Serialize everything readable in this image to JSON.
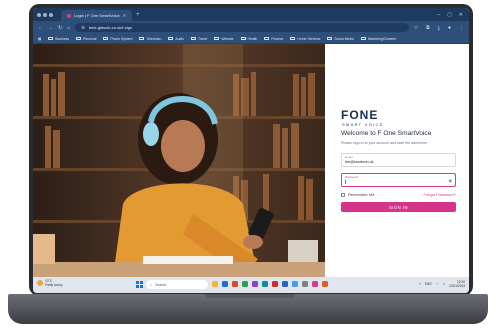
{
  "browser": {
    "tab_title": "Login | F One SmartVoice",
    "url": "fone.gbtsolo.co.uk/f-sign",
    "bookmarks": [
      "Business",
      "Personal",
      "Phone System",
      "Television",
      "Audio",
      "Travel",
      "Website",
      "Health",
      "Finance",
      "Home Services",
      "Social Media",
      "Marketing/Creative"
    ]
  },
  "login": {
    "logo": "FONE",
    "logo_sub": "SMART VOICE",
    "welcome": "Welcome to F One SmartVoice",
    "tagline": "Please sign-in to your account and start the adventure",
    "email_label": "Email",
    "email_value": "lee@fonetech.uk",
    "password_label": "Password",
    "remember": "Remember Me",
    "forgot": "Forgot Password?",
    "signin": "SIGN IN"
  },
  "taskbar": {
    "weather_temp": "10°C",
    "weather_desc": "Partly sunny",
    "search_placeholder": "Search",
    "time": "12:00",
    "date": "22/01/2024",
    "lang": "ENG",
    "app_colors": [
      "#f2b632",
      "#1f6fd1",
      "#e0452e",
      "#2e9e4f",
      "#8a3fd1",
      "#0f8a9e",
      "#cc2f2f",
      "#2d63c8",
      "#4a9be8",
      "#7b7f86",
      "#d93a8e",
      "#e05c1f"
    ]
  },
  "colors": {
    "brand_navy": "#16305a",
    "brand_pink": "#d6338a"
  }
}
